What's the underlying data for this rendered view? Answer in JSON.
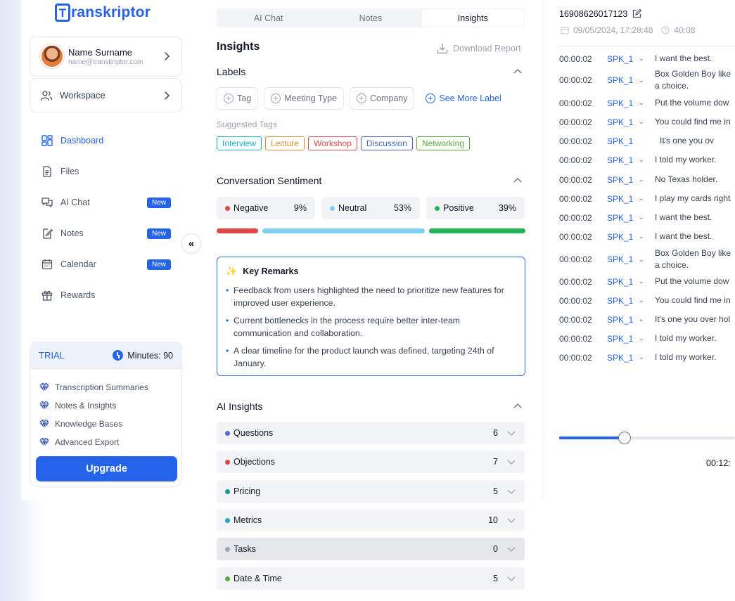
{
  "app": {
    "logo_letter": "T",
    "logo_rest": "ranskriptor",
    "brand_color": "#2563eb"
  },
  "user": {
    "name": "Name Surname",
    "email": "name@transkriptor.com"
  },
  "workspace": {
    "label": "Workspace"
  },
  "nav": {
    "items": [
      {
        "label": "Dashboard",
        "icon": "dashboard-icon",
        "active": true,
        "badge": ""
      },
      {
        "label": "Files",
        "icon": "files-icon",
        "badge": ""
      },
      {
        "label": "AI Chat",
        "icon": "ai-chat-icon",
        "badge": "New"
      },
      {
        "label": "Notes",
        "icon": "notes-icon",
        "badge": "New"
      },
      {
        "label": "Calendar",
        "icon": "calendar-icon",
        "badge": "New"
      },
      {
        "label": "Rewards",
        "icon": "gift-icon",
        "badge": ""
      }
    ]
  },
  "collapse": {
    "glyph": "«"
  },
  "trial": {
    "label": "TRIAL",
    "minutes": "Minutes: 90",
    "features": [
      "Transcription Summaries",
      "Notes & Insights",
      "Knowledge Bases",
      "Advanced Export"
    ],
    "upgrade": "Upgrade"
  },
  "tabs": [
    {
      "label": "AI Chat"
    },
    {
      "label": "Notes"
    },
    {
      "label": "Insights",
      "active": true
    }
  ],
  "insights": {
    "title": "Insights",
    "download": "Download Report",
    "labels": {
      "title": "Labels",
      "pills": [
        "Tag",
        "Meeting Type",
        "Company"
      ],
      "see_more": "See More Label",
      "suggested_title": "Suggested Tags",
      "suggested": [
        {
          "label": "Interview",
          "color": "#14b8c4"
        },
        {
          "label": "Lecture",
          "color": "#e08a2b"
        },
        {
          "label": "Workshop",
          "color": "#dc4a4a"
        },
        {
          "label": "Discussion",
          "color": "#4a64c8"
        },
        {
          "label": "Networking",
          "color": "#5aa63a"
        }
      ]
    },
    "sentiment": {
      "title": "Conversation Sentiment",
      "items": [
        {
          "label": "Negative",
          "value": "9%",
          "color": "#e04646"
        },
        {
          "label": "Neutral",
          "value": "53%",
          "color": "#7fd0f2"
        },
        {
          "label": "Positive",
          "value": "39%",
          "color": "#22b557"
        }
      ]
    },
    "remarks": {
      "title": "Key Remarks",
      "items": [
        "Feedback from users highlighted the need to prioritize new features for improved user experience.",
        "Current bottlenecks in the process require better inter-team communication and collaboration.",
        "A clear timeline for the product launch was defined, targeting 24th of January."
      ]
    },
    "ai": {
      "title": "AI Insights",
      "rows": [
        {
          "label": "Questions",
          "count": "6",
          "color": "#4f6bd8"
        },
        {
          "label": "Objections",
          "count": "7",
          "color": "#e04646"
        },
        {
          "label": "Pricing",
          "count": "5",
          "color": "#17989a"
        },
        {
          "label": "Metrics",
          "count": "10",
          "color": "#22a6c7"
        },
        {
          "label": "Tasks",
          "count": "0",
          "color": "#9ca3af"
        },
        {
          "label": "Date & Time",
          "count": "5",
          "color": "#5aa63a"
        }
      ]
    }
  },
  "file": {
    "id": "16908626017123",
    "date": "09/05/2024, 17:28:48",
    "duration": "40:08"
  },
  "transcript": [
    {
      "time": "00:00:02",
      "spk": "SPK_1",
      "text": "I want the best."
    },
    {
      "time": "00:00:02",
      "spk": "SPK_1",
      "text": "Box Golden Boy like",
      "text2": "a choice."
    },
    {
      "time": "00:00:02",
      "spk": "SPK_1",
      "text": "Put the volume dow"
    },
    {
      "time": "00:00:02",
      "spk": "SPK_1",
      "text": "You could find me in"
    },
    {
      "time": "00:00:02",
      "spk": "SPK_1",
      "text": "It's one you ov",
      "indent": true
    },
    {
      "time": "00:00:02",
      "spk": "SPK_1",
      "text": "I told my worker."
    },
    {
      "time": "00:00:02",
      "spk": "SPK_1",
      "text": "No Texas holder."
    },
    {
      "time": "00:00:02",
      "spk": "SPK_1",
      "text": "I play my cards right"
    },
    {
      "time": "00:00:02",
      "spk": "SPK_1",
      "text": "I want the best."
    },
    {
      "time": "00:00:02",
      "spk": "SPK_1",
      "text": "I want the best."
    },
    {
      "time": "00:00:02",
      "spk": "SPK_1",
      "text": "Box Golden Boy like",
      "text2": "a choice."
    },
    {
      "time": "00:00:02",
      "spk": "SPK_1",
      "text": "Put the volume dow"
    },
    {
      "time": "00:00:02",
      "spk": "SPK_1",
      "text": "You could find me in"
    },
    {
      "time": "00:00:02",
      "spk": "SPK_1",
      "text": "It's one you over hol"
    },
    {
      "time": "00:00:02",
      "spk": "SPK_1",
      "text": "I told my worker."
    },
    {
      "time": "00:00:02",
      "spk": "SPK_1",
      "text": "I told my worker."
    }
  ],
  "player": {
    "time": "00:12:",
    "progress": 0.37
  }
}
